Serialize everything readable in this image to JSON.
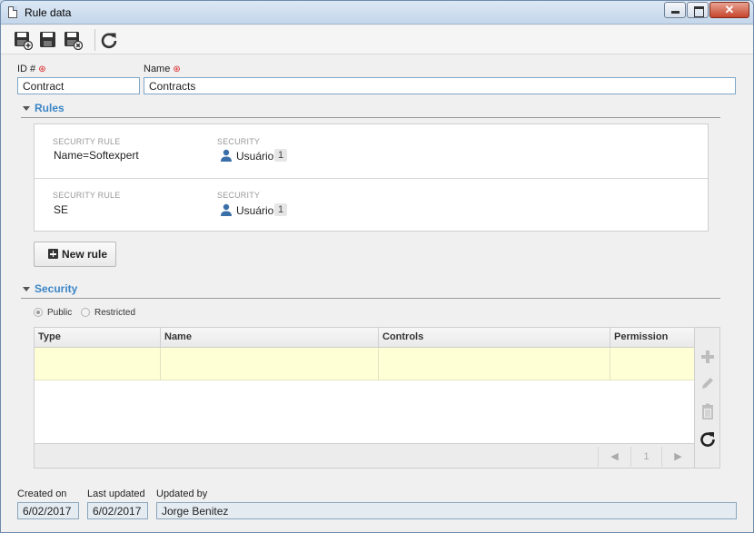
{
  "window": {
    "title": "Rule data",
    "close_glyph": "✕"
  },
  "toolbar": {
    "buttons": [
      {
        "name": "save-new-icon"
      },
      {
        "name": "save-icon"
      },
      {
        "name": "save-close-icon"
      },
      {
        "name": "refresh-icon"
      }
    ]
  },
  "form": {
    "id_label": "ID #",
    "id_value": "Contract",
    "name_label": "Name",
    "name_value": "Contracts",
    "required_mark": "⊛"
  },
  "rules_section": {
    "title": "Rules",
    "rules": [
      {
        "rule_caption": "SECURITY RULE",
        "rule_value": "Name=Softexpert",
        "security_caption": "SECURITY",
        "security_value": "Usuário",
        "count": "1"
      },
      {
        "rule_caption": "SECURITY RULE",
        "rule_value": "SE",
        "security_caption": "SECURITY",
        "security_value": "Usuário",
        "count": "1"
      }
    ],
    "new_rule_label": "New rule"
  },
  "security_section": {
    "title": "Security",
    "options": [
      {
        "label": "Public",
        "selected": true
      },
      {
        "label": "Restricted",
        "selected": false
      }
    ],
    "columns": [
      "Type",
      "Name",
      "Controls",
      "Permission"
    ],
    "pager": {
      "prev": "◀",
      "page": "1",
      "next": "▶"
    },
    "side_actions": [
      "add-icon",
      "edit-icon",
      "delete-icon",
      "refresh-icon"
    ]
  },
  "footer": {
    "created_label": "Created on",
    "created_value": "6/02/2017",
    "updated_label": "Last updated",
    "updated_value": "6/02/2017",
    "by_label": "Updated by",
    "by_value": "Jorge Benitez"
  },
  "colors": {
    "accent": "#3b86c6",
    "highlight_row": "#ffffd6",
    "required": "#d81f1f"
  }
}
